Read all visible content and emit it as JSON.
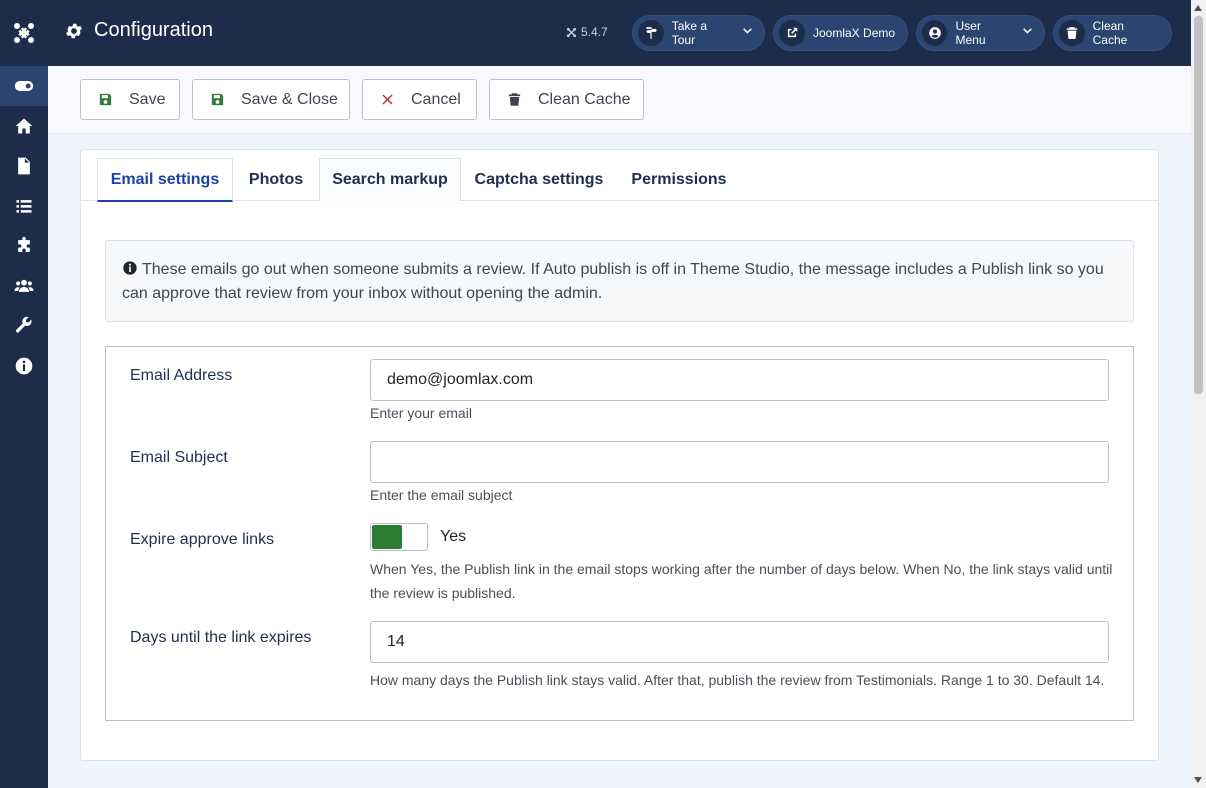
{
  "header": {
    "title": "Configuration",
    "version": "5.4.7",
    "buttons": [
      {
        "label": "Take a Tour",
        "icon": "signpost-icon",
        "has_dropdown": true
      },
      {
        "label": "JoomlaX Demo",
        "icon": "external-link-icon",
        "has_dropdown": false
      },
      {
        "label": "User Menu",
        "icon": "user-circle-icon",
        "has_dropdown": true
      },
      {
        "label": "Clean Cache",
        "icon": "trash-icon",
        "has_dropdown": false
      }
    ]
  },
  "sidebar": {
    "items": [
      {
        "icon": "toggle-icon",
        "active": true
      },
      {
        "icon": "home-icon"
      },
      {
        "icon": "file-icon"
      },
      {
        "icon": "list-icon"
      },
      {
        "icon": "puzzle-icon"
      },
      {
        "icon": "users-icon"
      },
      {
        "icon": "wrench-icon"
      },
      {
        "icon": "info-icon"
      }
    ]
  },
  "toolbar": {
    "save_label": "Save",
    "save_close_label": "Save & Close",
    "cancel_label": "Cancel",
    "clean_cache_label": "Clean Cache"
  },
  "tabs": [
    "Email settings",
    "Photos",
    "Search markup",
    "Captcha settings",
    "Permissions"
  ],
  "alert": {
    "text": "These emails go out when someone submits a review. If Auto publish is off in Theme Studio, the message includes a Publish link so you can approve that review from your inbox without opening the admin."
  },
  "form": {
    "email_address": {
      "label": "Email Address",
      "value": "demo@joomlax.com",
      "help": "Enter your email"
    },
    "email_subject": {
      "label": "Email Subject",
      "value": "",
      "help": "Enter the email subject"
    },
    "expire_links": {
      "label": "Expire approve links",
      "value": "Yes",
      "help": "When Yes, the Publish link in the email stops working after the number of days below. When No, the link stays valid until the review is published."
    },
    "days_expire": {
      "label": "Days until the link expires",
      "value": "14",
      "help": "How many days the Publish link stays valid. After that, publish the review from Testimonials. Range 1 to 30. Default 14."
    }
  },
  "colors": {
    "header_bg": "#1c2c4a",
    "accent": "#1c3faa",
    "toggle_on": "#2f7d32",
    "cancel_red": "#c52827",
    "save_green": "#2f7d32"
  }
}
